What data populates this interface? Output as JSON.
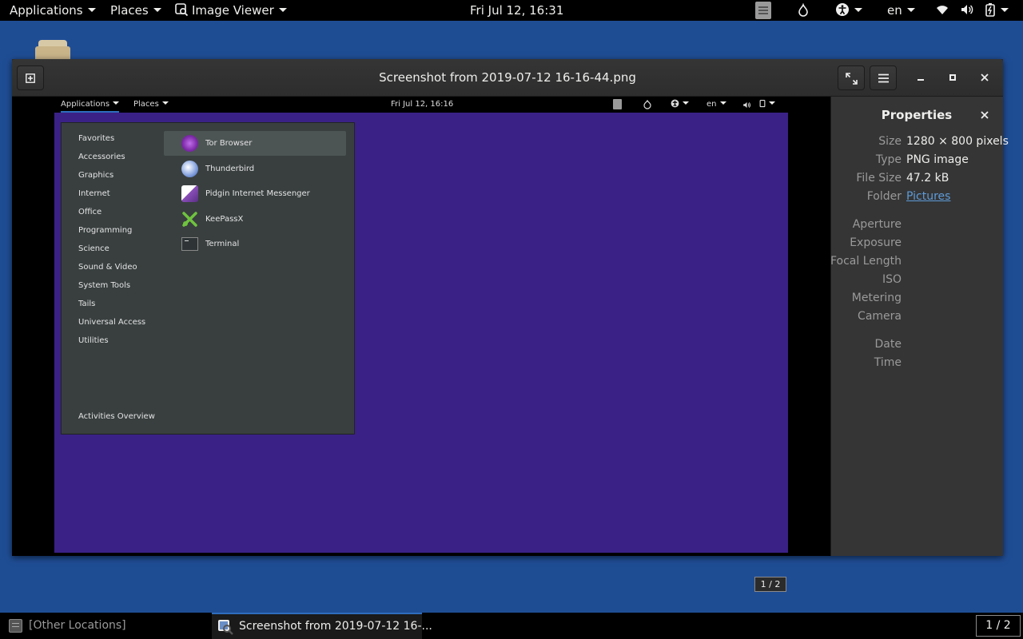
{
  "topbar": {
    "applications": "Applications",
    "places": "Places",
    "app_name": "Image Viewer",
    "clock": "Fri Jul 12, 16:31",
    "language": "en"
  },
  "window": {
    "title": "Screenshot from 2019-07-12 16-16-44.png",
    "page_counter": "1 / 2"
  },
  "screenshot": {
    "topbar": {
      "applications": "Applications",
      "places": "Places",
      "clock": "Fri Jul 12, 16:16",
      "language": "en"
    },
    "menu": {
      "categories": [
        "Favorites",
        "Accessories",
        "Graphics",
        "Internet",
        "Office",
        "Programming",
        "Science",
        "Sound & Video",
        "System Tools",
        "Tails",
        "Universal Access",
        "Utilities"
      ],
      "apps": [
        "Tor Browser",
        "Thunderbird",
        "Pidgin Internet Messenger",
        "KeePassX",
        "Terminal"
      ],
      "activities": "Activities Overview"
    },
    "colors": {
      "background": "#3a2186",
      "menu": "#393f3f"
    }
  },
  "properties": {
    "title": "Properties",
    "labels": {
      "size": "Size",
      "type": "Type",
      "file_size": "File Size",
      "folder": "Folder",
      "aperture": "Aperture",
      "exposure": "Exposure",
      "focal_length": "Focal Length",
      "iso": "ISO",
      "metering": "Metering",
      "camera": "Camera",
      "date": "Date",
      "time": "Time"
    },
    "values": {
      "size": "1280 × 800 pixels",
      "type": "PNG image",
      "file_size": "47.2 kB",
      "folder": "Pictures"
    }
  },
  "bottombar": {
    "other_locations": "[Other Locations]",
    "task": "Screenshot from 2019-07-12 16-...",
    "workspace": "1 / 2"
  },
  "colors": {
    "desktop": "#1f4d94",
    "link": "#5e9bd8",
    "accent": "#2d6dbd"
  }
}
